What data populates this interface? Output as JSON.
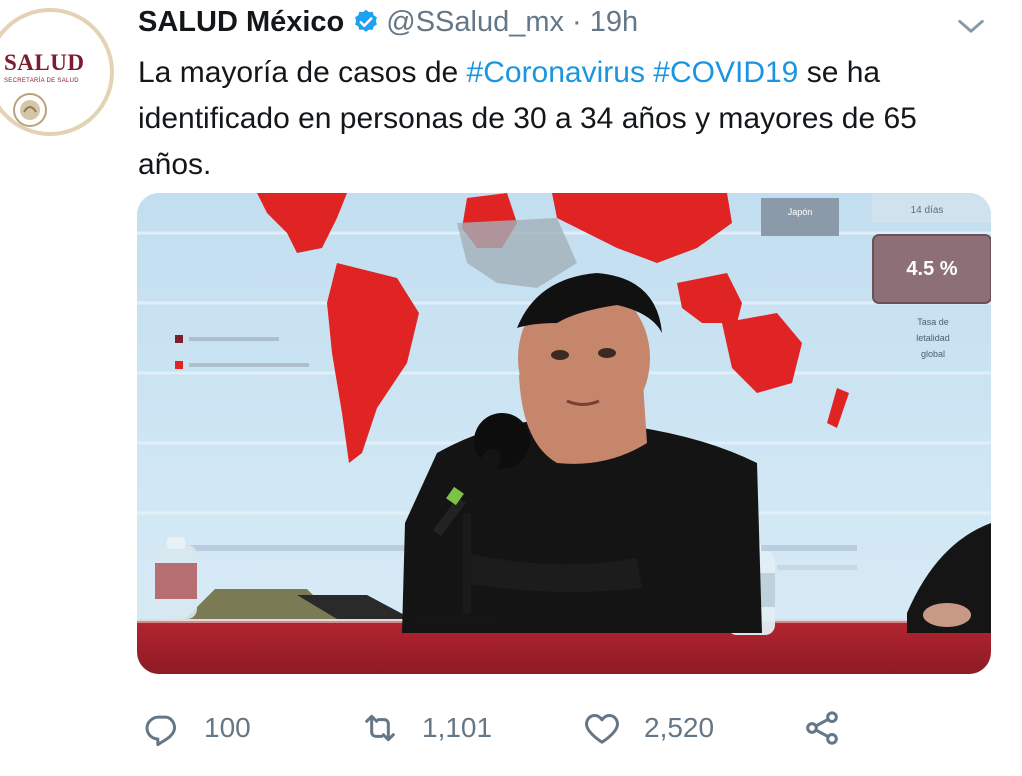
{
  "tweet": {
    "avatar": {
      "word": "SALUD",
      "subtitle": "SECRETARÍA DE SALUD"
    },
    "display_name": "SALUD México",
    "handle": "@SSalud_mx",
    "separator": "·",
    "time": "19h",
    "text": {
      "part1": "La mayoría de casos de ",
      "hashtag1": "#Coronavirus",
      "space": " ",
      "hashtag2": "#COVID19",
      "part2": " se ha identificado en personas de 30 a 34 años y mayores de 65 años."
    },
    "media": {
      "screen_labels": {
        "japan": "Japón",
        "days": "14 días",
        "rate": "4.5 %",
        "rate_caption_1": "Tasa de",
        "rate_caption_2": "letalidad",
        "rate_caption_3": "global"
      }
    },
    "actions": {
      "reply_count": "100",
      "retweet_count": "1,101",
      "like_count": "2,520"
    },
    "icons": {
      "verified": "verified-badge-icon",
      "menu": "chevron-down-icon",
      "reply": "reply-icon",
      "retweet": "retweet-icon",
      "like": "heart-icon",
      "share": "share-icon"
    },
    "colors": {
      "link": "#1b95e0",
      "muted": "#657786",
      "text": "#14171a",
      "brand": "#7a1d2f"
    }
  }
}
